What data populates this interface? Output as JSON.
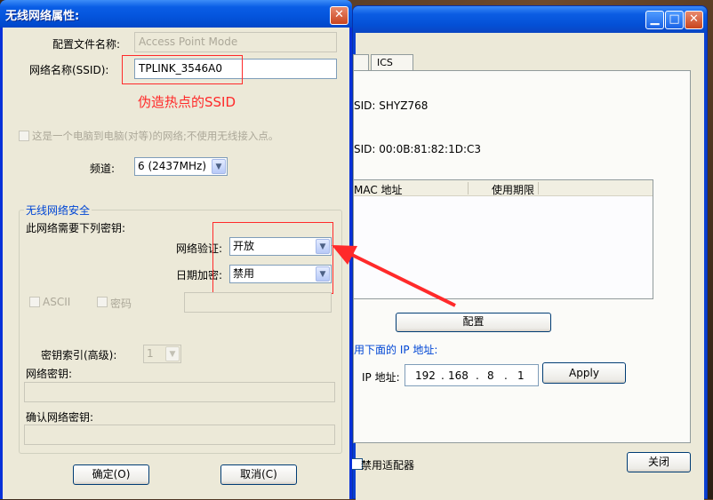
{
  "dialog": {
    "title": "无线网络属性:",
    "profile_name_label": "配置文件名称:",
    "profile_name_value": "Access Point Mode",
    "ssid_label": "网络名称(SSID):",
    "ssid_value": "TPLINK_3546A0",
    "annotation": "伪造热点的SSID",
    "adhoc_checkbox_label": "这是一个电脑到电脑(对等)的网络;不使用无线接入点。",
    "channel_label": "频道:",
    "channel_value": "6 (2437MHz)",
    "security_group_title": "无线网络安全",
    "security_need_key": "此网络需要下列密钥:",
    "auth_label": "网络验证:",
    "auth_value": "开放",
    "encryption_label": "日期加密:",
    "encryption_value": "禁用",
    "ascii_label": "ASCII",
    "password_label": "密码",
    "key_index_label": "密钥索引(高级):",
    "key_index_value": "1",
    "network_key_label": "网络密钥:",
    "confirm_key_label": "确认网络密钥:",
    "ok_button": "确定(O)",
    "cancel_button": "取消(C)"
  },
  "background_window": {
    "tab_ics": "ICS",
    "ssid_row": "SID: SHYZ768",
    "bssid_row": "SID: 00:0B:81:82:1D:C3",
    "col_mac": "MAC 地址",
    "col_lease": "使用期限",
    "config_button": "配置",
    "ip_section": "用下面的 IP 地址:",
    "ip_label": "IP 地址:",
    "ip_octets": [
      "192",
      "168",
      "8",
      "1"
    ],
    "apply_button": "Apply",
    "disable_adapter_label": "禁用适配器",
    "close_button": "关闭"
  },
  "colors": {
    "title_blue": "#0a5ee6",
    "annotation_red": "#ff2a2a",
    "dialog_face": "#ece9d8"
  }
}
